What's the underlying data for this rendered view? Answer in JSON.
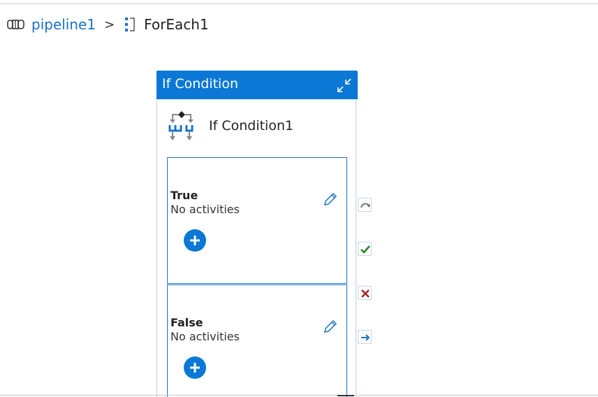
{
  "breadcrumb": {
    "pipeline_label": "pipeline1",
    "separator": ">",
    "current_label": "ForEach1"
  },
  "container": {
    "title": "If Condition",
    "activity_name": "If Condition1"
  },
  "branches": {
    "true": {
      "title": "True",
      "subtitle": "No activities"
    },
    "false": {
      "title": "False",
      "subtitle": "No activities"
    }
  },
  "icons": {
    "pipeline": "pipeline-icon",
    "foreach": "foreach-icon",
    "collapse": "collapse-icon",
    "if_condition": "if-condition-icon",
    "edit": "pencil-icon",
    "add": "plus-icon",
    "skip": "skip-arrow-icon",
    "success": "checkmark-icon",
    "failure": "x-icon",
    "completion": "arrow-right-icon"
  },
  "colors": {
    "accent": "#0a78d4",
    "link": "#1a73c4",
    "success": "#1e8a1e",
    "failure": "#a4262c"
  }
}
